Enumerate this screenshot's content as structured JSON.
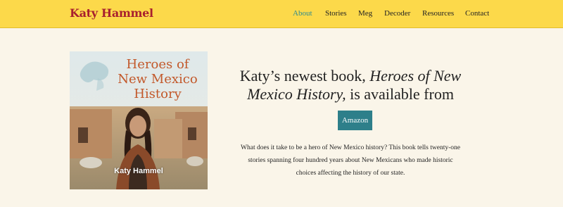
{
  "header": {
    "logo": "Katy Hammel",
    "nav": [
      "About",
      "Stories",
      "Meg",
      "Decoder",
      "Resources",
      "Contact"
    ],
    "active_nav": "About"
  },
  "book": {
    "cover_title": "Heroes of New Mexico History",
    "cover_author": "Katy Hammel"
  },
  "headline": {
    "prefix": "Katy’s newest book, ",
    "title": "Heroes of New Mexico History,",
    "suffix": " is available from"
  },
  "buy_button": "Amazon",
  "description": "What does it take to be a hero of New Mexico history? This book tells twenty-one stories spanning four hundred years about New Mexicans who made historic choices affecting the history of our state.",
  "colors": {
    "header_bg": "#fcd94a",
    "logo": "#a8202e",
    "accent": "#2e8b8f",
    "button_bg": "#2e7f8a",
    "page_bg": "#faf5e9"
  }
}
